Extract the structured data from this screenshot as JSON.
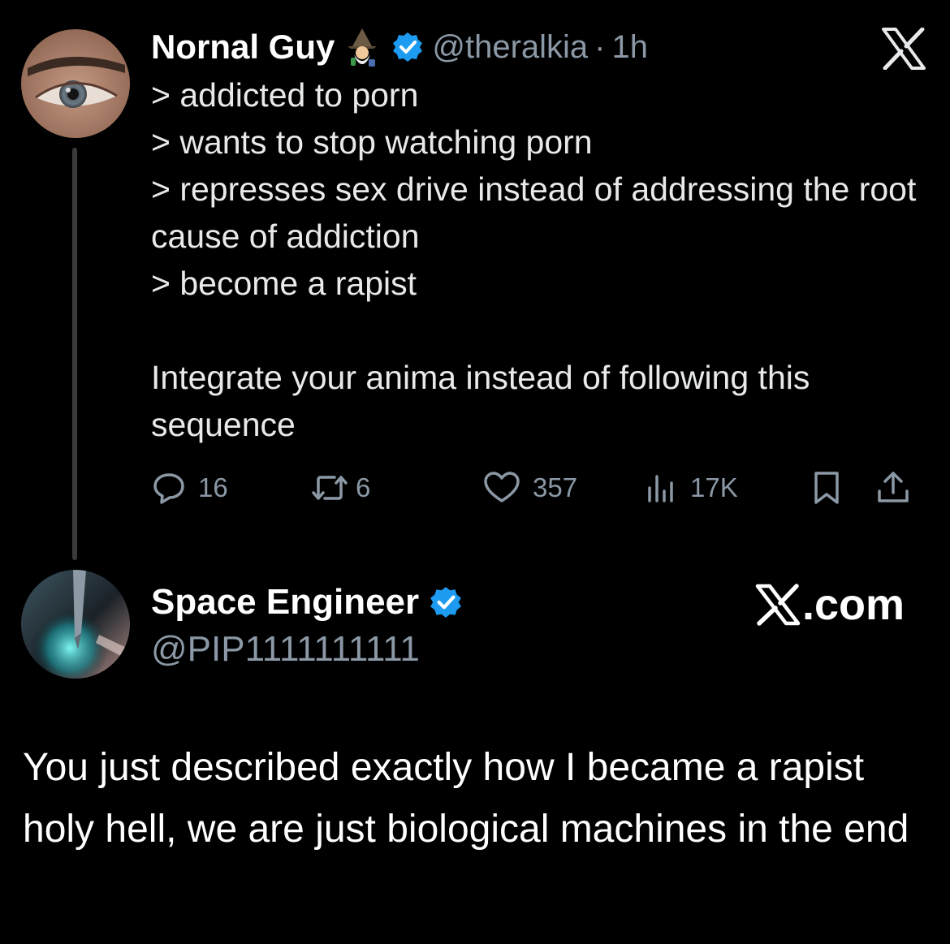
{
  "tweet": {
    "author": {
      "display_name": "Nornal Guy",
      "name_emoji": "wizard-emoji",
      "verified": true,
      "handle": "@theralkia",
      "separator": "·",
      "time": "1h"
    },
    "text_lines": [
      "> addicted to porn",
      "> wants to stop watching porn",
      "> represses sex drive instead of addressing the root cause of addiction",
      "> become a rapist"
    ],
    "text_paragraph": "Integrate your anima instead of following this sequence",
    "actions": {
      "reply_icon": "reply-icon",
      "reply_count": "16",
      "retweet_icon": "retweet-icon",
      "retweet_count": "6",
      "like_icon": "heart-icon",
      "like_count": "357",
      "views_icon": "views-icon",
      "views_count": "17K",
      "bookmark_icon": "bookmark-icon",
      "share_icon": "share-icon"
    },
    "platform_logo": "x-logo"
  },
  "reply": {
    "author": {
      "display_name": "Space Engineer",
      "verified": true,
      "handle": "@PIP1111111111"
    },
    "watermark": ".com",
    "text": "You just described exactly how I became a rapist holy hell, we are just biological machines in the end"
  },
  "colors": {
    "background": "#000000",
    "text_primary": "#e7e9ea",
    "text_secondary": "#8b98a5",
    "verified_blue": "#1d9bf0",
    "thread_line": "#3a3a3a"
  }
}
